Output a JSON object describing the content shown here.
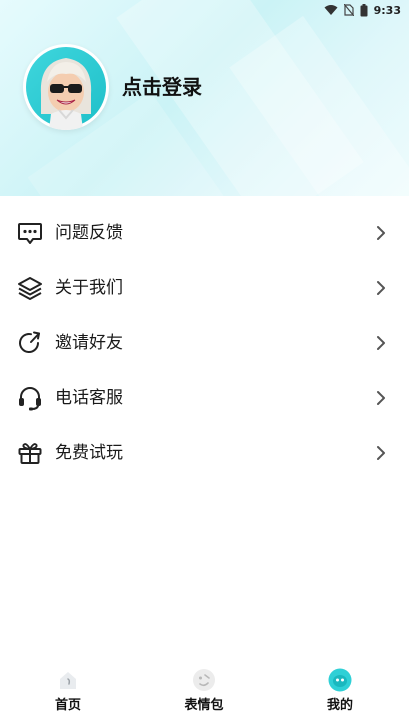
{
  "status_bar": {
    "time": "9:33"
  },
  "profile": {
    "login_label": "点击登录",
    "avatar_icon": "avatar-sunglasses-icon"
  },
  "menu": {
    "items": [
      {
        "label": "问题反馈",
        "icon": "feedback-icon"
      },
      {
        "label": "关于我们",
        "icon": "layers-icon"
      },
      {
        "label": "邀请好友",
        "icon": "share-refresh-icon"
      },
      {
        "label": "电话客服",
        "icon": "headset-icon"
      },
      {
        "label": "免费试玩",
        "icon": "gift-icon"
      }
    ]
  },
  "tabbar": {
    "tabs": [
      {
        "label": "首页",
        "icon": "home-icon",
        "active": false
      },
      {
        "label": "表情包",
        "icon": "emoji-icon",
        "active": false
      },
      {
        "label": "我的",
        "icon": "profile-face-icon",
        "active": true
      }
    ]
  },
  "colors": {
    "header_accent": "#cbf3f6",
    "active_tab": "#2fd0d6",
    "icon_stroke": "#222222",
    "arrow": "#666666"
  }
}
